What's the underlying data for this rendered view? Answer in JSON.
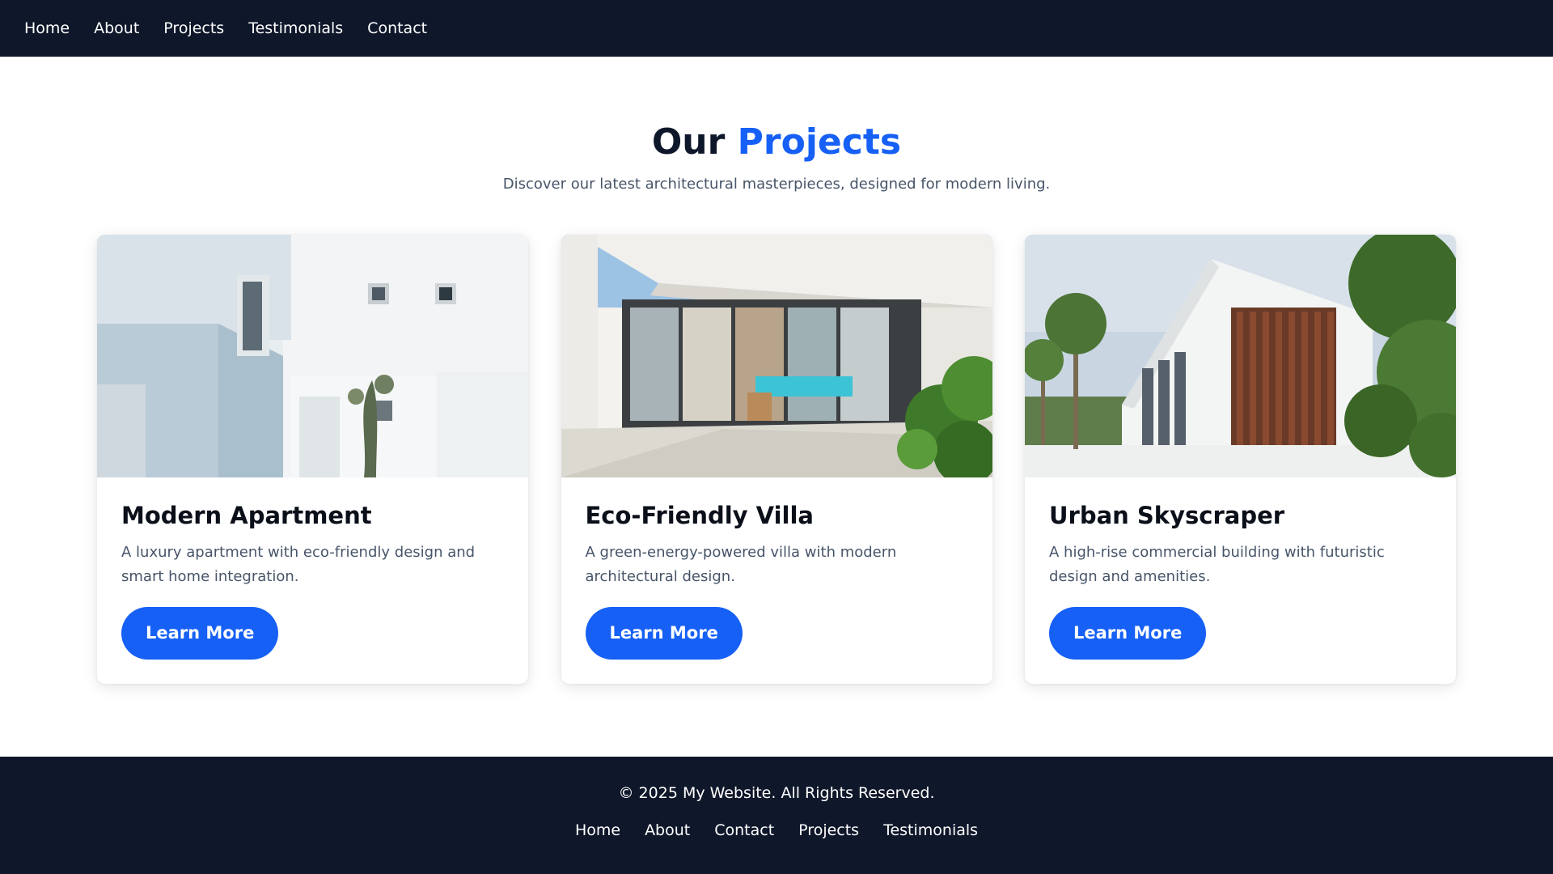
{
  "nav": {
    "links": [
      "Home",
      "About",
      "Projects",
      "Testimonials",
      "Contact"
    ]
  },
  "header": {
    "title_prefix": "Our",
    "title_accent": "Projects",
    "subtitle": "Discover our latest architectural masterpieces, designed for modern living."
  },
  "projects": [
    {
      "title": "Modern Apartment",
      "description": "A luxury apartment with eco-friendly design and smart home integration.",
      "button": "Learn More",
      "image": "modern-white-apartment-photo"
    },
    {
      "title": "Eco-Friendly Villa",
      "description": "A green-energy-powered villa with modern architectural design.",
      "button": "Learn More",
      "image": "glass-villa-with-pool-photo"
    },
    {
      "title": "Urban Skyscraper",
      "description": "A high-rise commercial building with futuristic design and amenities.",
      "button": "Learn More",
      "image": "white-building-with-palm-trees-photo"
    }
  ],
  "footer": {
    "copyright": "© 2025 My Website. All Rights Reserved.",
    "links": [
      "Home",
      "About",
      "Contact",
      "Projects",
      "Testimonials"
    ]
  },
  "colors": {
    "navy": "#0f172a",
    "accent": "#1660f5",
    "muted_text": "#475569"
  }
}
